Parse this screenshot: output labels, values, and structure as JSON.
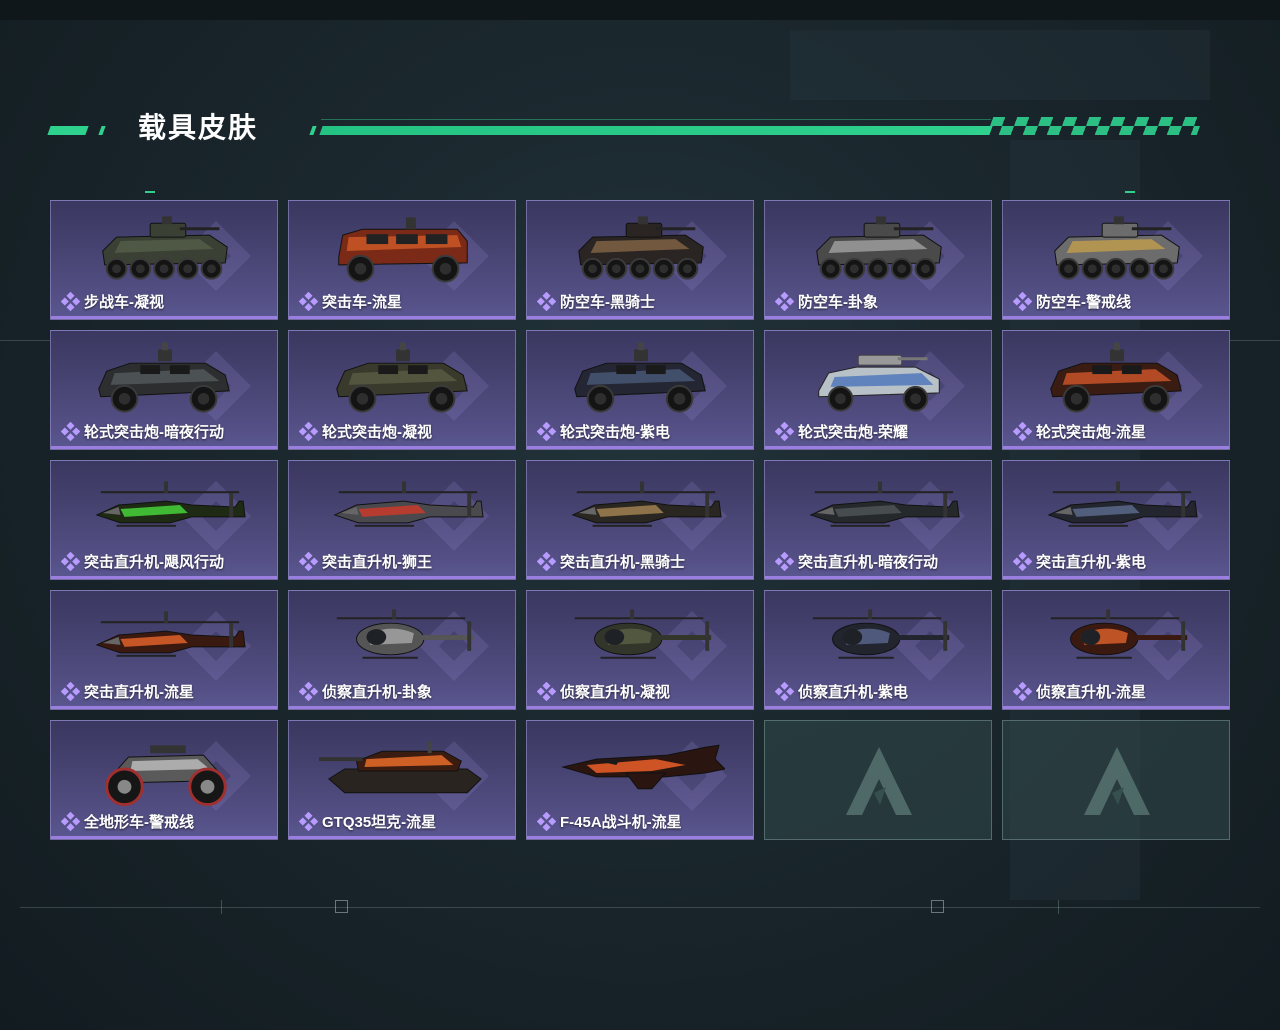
{
  "page": {
    "title": "载具皮肤",
    "accent": "#2fd18e",
    "card_accent": "#9a7fe0"
  },
  "skins": [
    {
      "label": "步战车-凝视",
      "kind": "apc8",
      "palette": [
        "#3b4034",
        "#556049"
      ]
    },
    {
      "label": "突击车-流星",
      "kind": "truck",
      "palette": [
        "#7a2a16",
        "#d05a28"
      ]
    },
    {
      "label": "防空车-黑骑士",
      "kind": "apc8",
      "palette": [
        "#2a2522",
        "#8a6a48"
      ]
    },
    {
      "label": "防空车-卦象",
      "kind": "apc8",
      "palette": [
        "#4a4a4a",
        "#a8a8a8"
      ]
    },
    {
      "label": "防空车-警戒线",
      "kind": "apc8",
      "palette": [
        "#6c6c6c",
        "#c8a24a"
      ]
    },
    {
      "label": "轮式突击炮-暗夜行动",
      "kind": "car4",
      "palette": [
        "#2c2e30",
        "#555a5e"
      ]
    },
    {
      "label": "轮式突击炮-凝视",
      "kind": "car4",
      "palette": [
        "#3a3a2c",
        "#5a5c44"
      ]
    },
    {
      "label": "轮式突击炮-紫电",
      "kind": "car4",
      "palette": [
        "#242633",
        "#4a5a78"
      ]
    },
    {
      "label": "轮式突击炮-荣耀",
      "kind": "buggy",
      "palette": [
        "#b8c0c8",
        "#3a6ab8"
      ]
    },
    {
      "label": "轮式突击炮-流星",
      "kind": "car4",
      "palette": [
        "#3a1c12",
        "#d0562a"
      ]
    },
    {
      "label": "突击直升机-飓风行动",
      "kind": "attack",
      "palette": [
        "#1e2a14",
        "#46d23a"
      ]
    },
    {
      "label": "突击直升机-狮王",
      "kind": "attack",
      "palette": [
        "#4a4a4e",
        "#c83a2a"
      ]
    },
    {
      "label": "突击直升机-黑骑士",
      "kind": "attack",
      "palette": [
        "#2a2622",
        "#a08050"
      ]
    },
    {
      "label": "突击直升机-暗夜行动",
      "kind": "attack",
      "palette": [
        "#26292b",
        "#4e5356"
      ]
    },
    {
      "label": "突击直升机-紫电",
      "kind": "attack",
      "palette": [
        "#23252f",
        "#5a6a8a"
      ]
    },
    {
      "label": "突击直升机-流星",
      "kind": "attack",
      "palette": [
        "#3a1a10",
        "#e0622a"
      ]
    },
    {
      "label": "侦察直升机-卦象",
      "kind": "scout",
      "palette": [
        "#555555",
        "#a8a8a8"
      ]
    },
    {
      "label": "侦察直升机-凝视",
      "kind": "scout",
      "palette": [
        "#32362a",
        "#5a6046"
      ]
    },
    {
      "label": "侦察直升机-紫电",
      "kind": "scout",
      "palette": [
        "#22242e",
        "#5a6690"
      ]
    },
    {
      "label": "侦察直升机-流星",
      "kind": "scout",
      "palette": [
        "#3a1a10",
        "#e0622a"
      ]
    },
    {
      "label": "全地形车-警戒线",
      "kind": "atv",
      "palette": [
        "#5a5a5a",
        "#c8c8c8"
      ]
    },
    {
      "label": "GTQ35坦克-流星",
      "kind": "tank",
      "palette": [
        "#3a1c10",
        "#e06828"
      ]
    },
    {
      "label": "F-45A战斗机-流星",
      "kind": "jet",
      "palette": [
        "#2a1510",
        "#e05a28"
      ]
    }
  ],
  "empty_slots": 2,
  "empty_icon": "logo-icon"
}
